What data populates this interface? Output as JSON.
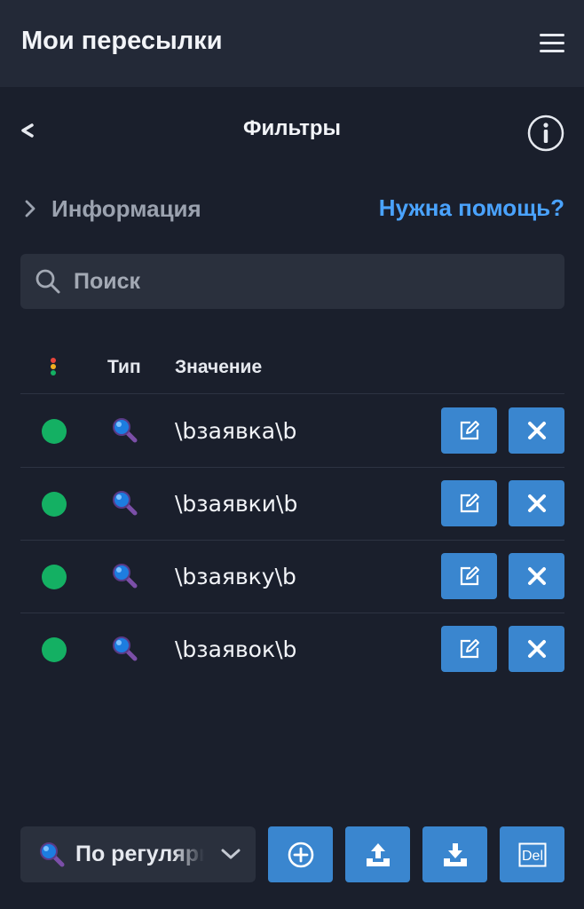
{
  "header": {
    "title": "Мои пересылки",
    "menu_icon": "hamburger-menu-icon"
  },
  "subheader": {
    "back_label": "<",
    "title": "Фильтры",
    "info_icon": "info-circle-icon"
  },
  "info_section": {
    "label": "Информация",
    "help_link": "Нужна помощь?"
  },
  "search": {
    "placeholder": "Поиск",
    "value": ""
  },
  "table": {
    "columns": {
      "status": "",
      "type": "Тип",
      "value": "Значение"
    },
    "rows": [
      {
        "status": "active",
        "type_icon": "magnifier-icon",
        "value": "\\bзаявка\\b"
      },
      {
        "status": "active",
        "type_icon": "magnifier-icon",
        "value": "\\bзаявки\\b"
      },
      {
        "status": "active",
        "type_icon": "magnifier-icon",
        "value": "\\bзаявку\\b"
      },
      {
        "status": "active",
        "type_icon": "magnifier-icon",
        "value": "\\bзаявок\\b"
      }
    ]
  },
  "footer": {
    "mode_select": {
      "selected": "По регулярным выражениям",
      "icon": "magnifier-icon"
    },
    "buttons": [
      {
        "name": "add",
        "icon": "plus-circle-icon"
      },
      {
        "name": "export",
        "icon": "upload-icon"
      },
      {
        "name": "import",
        "icon": "download-icon"
      },
      {
        "name": "delete-all",
        "label": "Del",
        "icon": "del-icon"
      }
    ]
  },
  "colors": {
    "background": "#1a1f2c",
    "appbar": "#232937",
    "accent_button": "#3a86cf",
    "link": "#4aa3ff",
    "status_active": "#14b063"
  }
}
